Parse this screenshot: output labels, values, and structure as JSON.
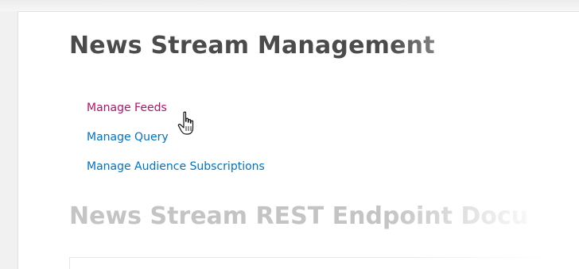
{
  "page": {
    "title": "News Stream Management",
    "links": [
      {
        "label": "Manage Feeds"
      },
      {
        "label": "Manage Query"
      },
      {
        "label": "Manage Audience Subscriptions"
      }
    ],
    "section_title": "News Stream REST Endpoint Docu"
  },
  "colors": {
    "link": "#0072c6",
    "link_hover": "#b0126b",
    "title": "#4b4b4b"
  },
  "cursor": {
    "icon": "hand-pointer-icon"
  }
}
